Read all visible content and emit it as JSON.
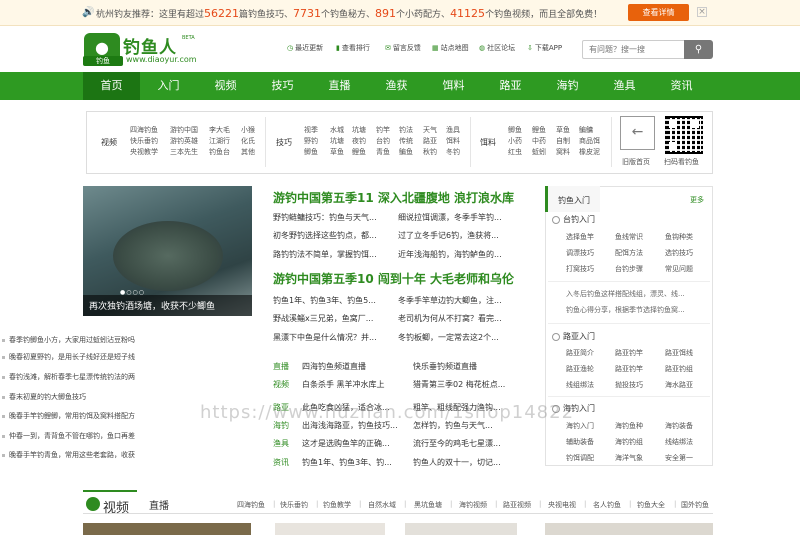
{
  "notice": {
    "prefix": "杭州钓友推荐：这里有超过",
    "n1": "56221",
    "t1": "篇钓鱼技巧、",
    "n2": "7731",
    "t2": "个钓鱼秘方、",
    "n3": "891",
    "t3": "个小药配方、",
    "n4": "41125",
    "t4": "个钓鱼视频，而且全部免费！",
    "button": "查看详情",
    "close": "×"
  },
  "logo": {
    "name": "钓鱼人",
    "beta": "BETA",
    "url": "www.diaoyur.com",
    "badge": "钓鱼"
  },
  "quick_links": [
    "最近更新",
    "查看排行",
    "留言反馈",
    "站点地图",
    "社区论坛",
    "下载APP"
  ],
  "search": {
    "placeholder": "有问题？搜一搜"
  },
  "nav": [
    "首页",
    "入门",
    "视频",
    "技巧",
    "直播",
    "渔获",
    "饵料",
    "路亚",
    "海钓",
    "渔具",
    "资讯"
  ],
  "categories": {
    "video": {
      "title": "视频",
      "cols": [
        [
          "四海钓鱼",
          "快乐垂钓",
          "央视教学"
        ],
        [
          "游钓中国",
          "游钓英雄",
          "三本先生"
        ],
        [
          "李大毛",
          "江湖行",
          "钓鱼台"
        ],
        [
          "小猴",
          "化氏",
          "其他"
        ]
      ]
    },
    "skills": {
      "title": "技巧",
      "cols": [
        [
          "视季",
          "野钓",
          "鲫鱼"
        ],
        [
          "水城",
          "坑塘",
          "草鱼"
        ],
        [
          "坑塘",
          "夜钓",
          "鲤鱼"
        ],
        [
          "钓竿",
          "台钓",
          "青鱼"
        ],
        [
          "钓法",
          "传统",
          "鳊鱼"
        ],
        [
          "天气",
          "路亚",
          "秋钓"
        ],
        [
          "渔具",
          "饵料",
          "冬钓"
        ]
      ]
    },
    "bait": {
      "title": "饵料",
      "cols": [
        [
          "鲫鱼",
          "小药",
          "红虫"
        ],
        [
          "鲤鱼",
          "中药",
          "蚯蚓"
        ],
        [
          "草鱼",
          "自制",
          "窝料"
        ],
        [
          "鳊鳙",
          "商品饵",
          "橡皮泥"
        ]
      ]
    },
    "old_home": "旧版首页",
    "qr_caption": "扫码看钓鱼"
  },
  "slider": {
    "caption": "再次独钓酒场塘，收获不少鲫鱼",
    "overlay_text": "不少鲫鱼"
  },
  "left_list": [
    "春季钓鲫鱼小方，大家用过蚯蚓沾豆粉吗",
    "晚春初夏野钓，是用长子线好还是短子线",
    "春钓浅滩，解析春季七星漂传统钓法的两",
    "春末初夏的钓大鲫鱼技巧",
    "晚春手竿钓鲤鲫，常用钓饵及窝料搭配方",
    "仲春一到，青背鱼不管在哪钓，鱼口再差",
    "晚春手竿钓青鱼，常用这些老套路，收获"
  ],
  "headline1": "游钓中国第五季11 深入北疆腹地 浪打浪水库",
  "block1": [
    [
      "野钓鲢鳙技巧：钓鱼与天气...",
      "细说拉饵调漂，冬季手竿钓..."
    ],
    [
      "初冬野钓选择这些钓点，都...",
      "过了立冬手记6钓，渔获将..."
    ],
    [
      "路钓钓法不简单，掌握钓饵...",
      "近年浅海船钓，海钓鲈鱼的..."
    ]
  ],
  "headline2": "游钓中国第五季10 闯到十年 大毛老师和乌伦",
  "block2": [
    [
      "钓鱼1年、钓鱼3年、钓鱼5...",
      "冬季手竿草边钓大鲫鱼，注..."
    ],
    [
      "野战溪鲻x三兄弟，鱼窝厂...",
      "老司机为何从不打窝？看完..."
    ],
    [
      "黑漂下中鱼是什么情况？并...",
      "冬钓板鲫，一定常去这2个..."
    ]
  ],
  "tag_rows": [
    {
      "tag": "直播",
      "a": "四海钓鱼频道直播",
      "b": "快乐垂钓频道直播"
    },
    {
      "tag": "视频",
      "a": "白条杀手 黑羊冲水库上",
      "b": "猎青第三季02 梅花桩点..."
    },
    {
      "tag": "路亚",
      "a": "此鱼吃食凶猛，适合冰...",
      "b": "粗竿、粗线配强力渔钩..."
    },
    {
      "tag": "海钓",
      "a": "出海浅海路亚，钓鱼技巧...",
      "b": "怎样钓，钓鱼与天气..."
    },
    {
      "tag": "渔具",
      "a": "这才是选购鱼竿的正确...",
      "b": "流行至今的鸡毛七星漂..."
    },
    {
      "tag": "资讯",
      "a": "钓鱼1年、钓鱼3年、钓...",
      "b": "钓鱼人的双十一，切记..."
    }
  ],
  "sidebar": {
    "tab": "钓鱼入门",
    "more": "更多",
    "sec1": "台钓入门",
    "sec1_links": [
      [
        "选择鱼竿",
        "鱼线常识",
        "鱼钩种类"
      ],
      [
        "调漂技巧",
        "配饵方法",
        "选钓技巧"
      ],
      [
        "打窝技巧",
        "台钓步骤",
        "常见问题"
      ]
    ],
    "note1": "入冬后钓鱼这样搭配线组，漂灵、线...",
    "note2": "钓鱼心得分享，根据季节选择钓鱼窝...",
    "sec2": "路亚入门",
    "sec2_links": [
      [
        "路亚简介",
        "路亚钓竿",
        "路亚饵线"
      ],
      [
        "路亚渔轮",
        "路亚钓竿",
        "路亚钓组"
      ],
      [
        "线组绑法",
        "抛投技巧",
        "海水路亚"
      ]
    ],
    "sec3": "海钓入门",
    "sec3_links": [
      [
        "海钓入门",
        "海钓鱼种",
        "海钓装备"
      ],
      [
        "辅助装备",
        "海钓钓组",
        "线结绑法"
      ],
      [
        "钓饵调配",
        "海洋气象",
        "安全第一"
      ]
    ]
  },
  "video_section": {
    "title": "视频",
    "live": "直播",
    "links": [
      "四海钓鱼",
      "快乐垂钓",
      "钓鱼教学",
      "自然水域",
      "黑坑鱼塘",
      "海钓视频",
      "路亚视频",
      "央视电视",
      "名人钓鱼",
      "钓鱼大全",
      "国外钓鱼"
    ]
  },
  "watermark": "https://www.huzhan.com/1shop14822"
}
